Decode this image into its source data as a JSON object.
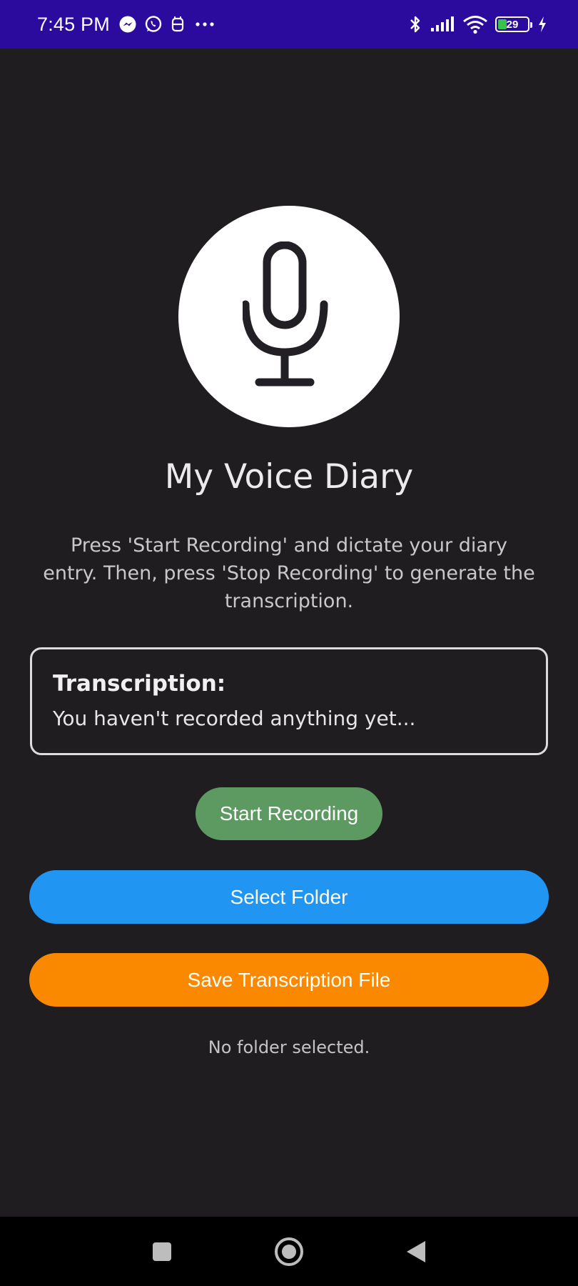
{
  "status_bar": {
    "time": "7:45 PM",
    "left_icons": [
      "messenger-icon",
      "whatsapp-icon",
      "notification-app-icon",
      "more-dots-icon"
    ],
    "right_icons": [
      "bluetooth-icon",
      "signal-icon",
      "wifi-icon",
      "battery-icon",
      "charging-icon"
    ],
    "battery_level": "29",
    "battery_color": "#39c24a",
    "bar_color": "#2b0a9e"
  },
  "main": {
    "mic_icon": "microphone-icon",
    "title": "My Voice Diary",
    "description": "Press 'Start Recording' and dictate your diary entry. Then, press 'Stop Recording' to generate the transcription.",
    "transcription": {
      "label": "Transcription:",
      "text": "You haven't recorded anything yet..."
    },
    "buttons": {
      "start_recording": "Start Recording",
      "select_folder": "Select Folder",
      "save_file": "Save Transcription File"
    },
    "folder_status": "No folder selected."
  },
  "colors": {
    "background": "#1f1d20",
    "start_button": "#5c9a62",
    "folder_button": "#2195f2",
    "save_button": "#fb8900"
  },
  "nav_bar": {
    "icons": [
      "recents-square-icon",
      "home-circle-icon",
      "back-triangle-icon"
    ]
  }
}
